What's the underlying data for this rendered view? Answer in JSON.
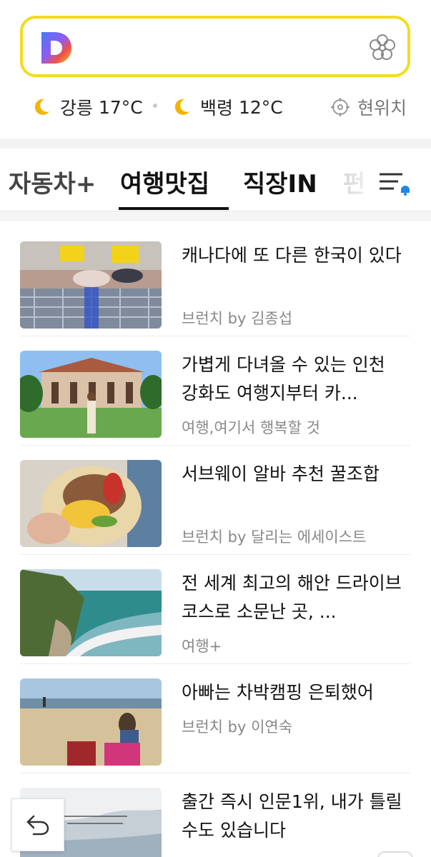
{
  "search": {
    "placeholder": ""
  },
  "weather": [
    {
      "city": "강릉",
      "temp": "17°C"
    },
    {
      "city": "백령",
      "temp": "12°C"
    }
  ],
  "location_label": "현위치",
  "tabs": [
    {
      "label": "자동차+",
      "active": false
    },
    {
      "label": "여행맛집",
      "active": true
    },
    {
      "label": "직장IN",
      "active": false
    },
    {
      "label": "펀",
      "active": false
    }
  ],
  "articles": [
    {
      "title": "캐나다에 또 다른 한국이 있다",
      "meta": "브런치 by 김종섭"
    },
    {
      "title": "가볍게 다녀올 수 있는 인천 강화도 여행지부터 카...",
      "meta": "여행,여기서 행복할 것"
    },
    {
      "title": "서브웨이 알바 추천 꿀조합",
      "meta": "브런치 by 달리는 에세이스트"
    },
    {
      "title": "전 세계 최고의 해안 드라이브 코스로 소문난 곳, ...",
      "meta": "여행+"
    },
    {
      "title": "아빠는 차박캠핑 은퇴했어",
      "meta": "브런치 by 이연숙"
    },
    {
      "title": "출간 즉시 인문1위, 내가 틀릴 수도 있습니다",
      "meta": ""
    }
  ],
  "colors": {
    "accent": "#f2dc1c",
    "notify": "#1e88e5"
  }
}
